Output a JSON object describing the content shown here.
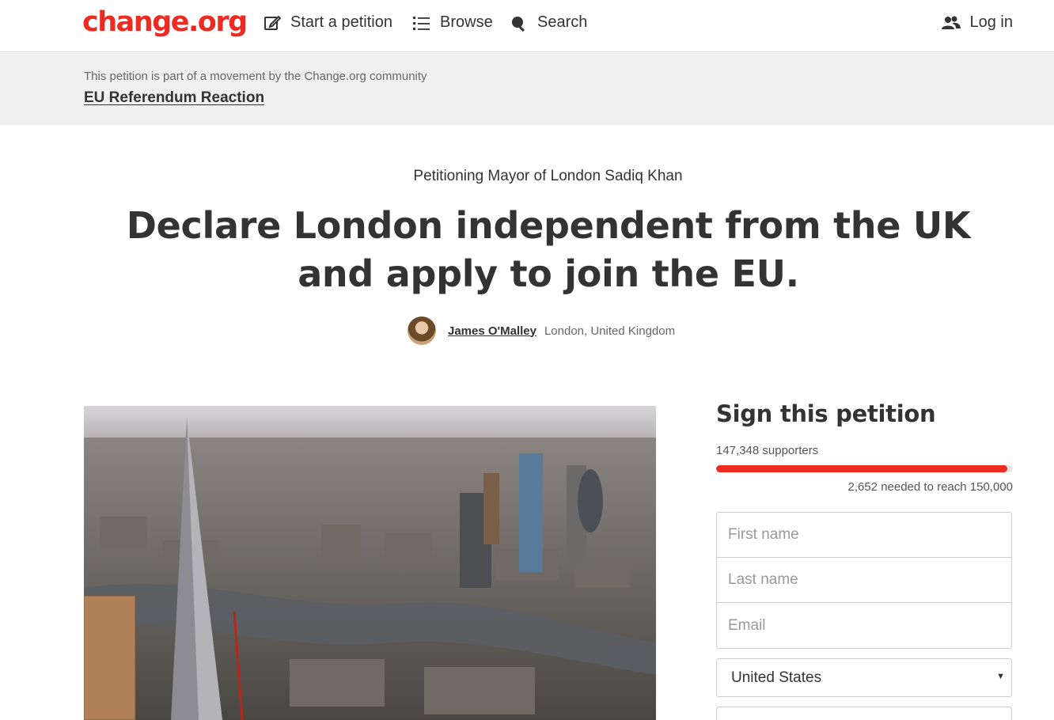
{
  "header": {
    "logo": "change.org",
    "nav": {
      "start_petition": "Start a petition",
      "browse": "Browse",
      "search": "Search",
      "login": "Log in"
    }
  },
  "banner": {
    "text": "This petition is part of a movement by the Change.org community",
    "link": "EU Referendum Reaction"
  },
  "petition": {
    "petitioning": "Petitioning Mayor of London Sadiq Khan",
    "title": "Declare London independent from the UK and apply to join the EU.",
    "author_name": "James O'Malley",
    "author_location": "London, United Kingdom"
  },
  "sign": {
    "title": "Sign this petition",
    "supporters": "147,348 supporters",
    "progress_fraction": 0.982,
    "needed": "2,652 needed to reach 150,000",
    "first_name_placeholder": "First name",
    "last_name_placeholder": "Last name",
    "email_placeholder": "Email",
    "country": "United States"
  },
  "colors": {
    "brand": "#ec2c22",
    "banner_bg": "#f0f0f0"
  },
  "icons": [
    "edit-icon",
    "list-icon",
    "search-icon",
    "user-group-icon",
    "caret-down-icon"
  ]
}
